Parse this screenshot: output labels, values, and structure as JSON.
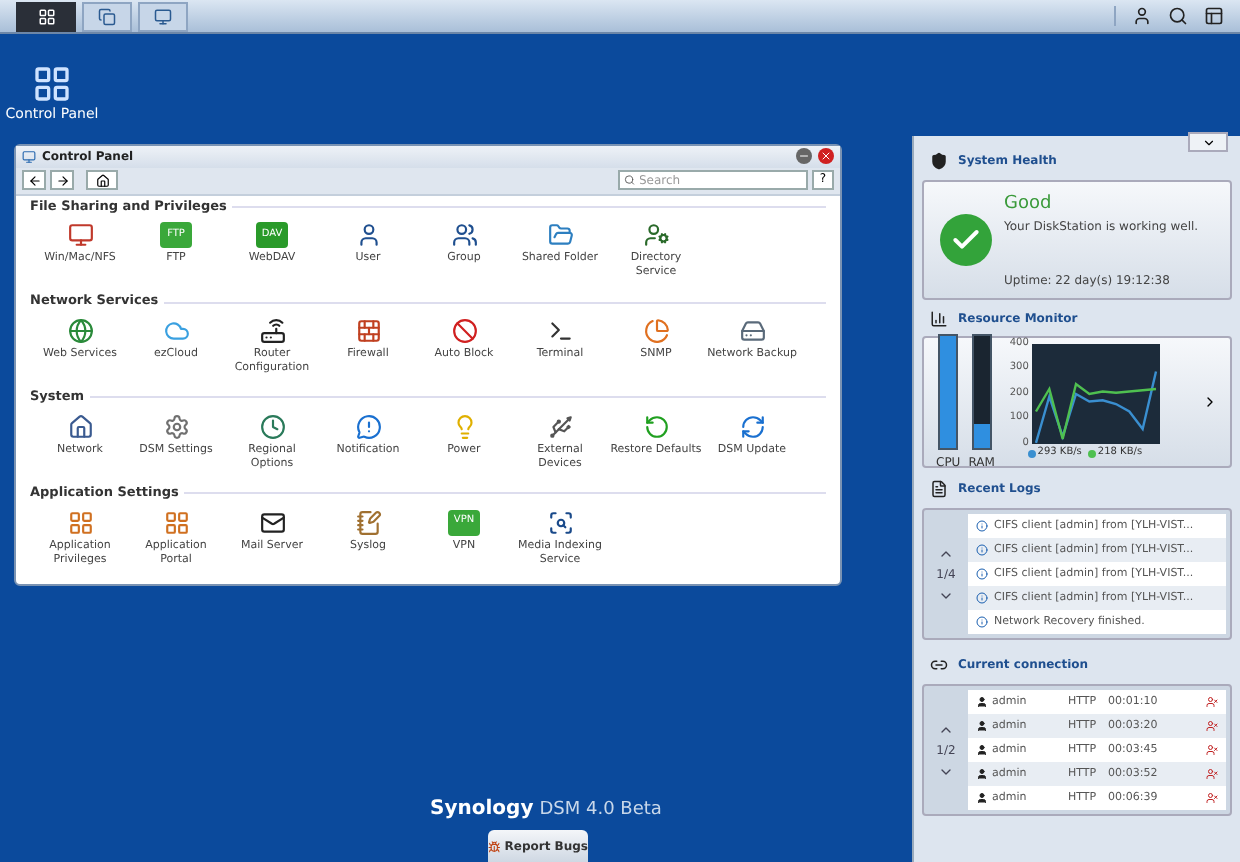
{
  "taskbar": {
    "buttons": [
      {
        "selected": true
      },
      {
        "selected": false
      },
      {
        "selected": false
      }
    ]
  },
  "desktop_icons": [
    {
      "label": "Control Panel"
    }
  ],
  "control_panel": {
    "title": "Control Panel",
    "search": {
      "placeholder": "Search"
    },
    "help": "?",
    "sections": [
      {
        "title": "File Sharing and Privileges",
        "items": [
          {
            "label": "Win/Mac/NFS"
          },
          {
            "label": "FTP",
            "badge": "FTP"
          },
          {
            "label": "WebDAV",
            "badge": "DAV"
          },
          {
            "label": "User"
          },
          {
            "label": "Group"
          },
          {
            "label": "Shared Folder"
          },
          {
            "label": "Directory Service"
          }
        ]
      },
      {
        "title": "Network Services",
        "items": [
          {
            "label": "Web Services"
          },
          {
            "label": "ezCloud"
          },
          {
            "label": "Router Configuration"
          },
          {
            "label": "Firewall"
          },
          {
            "label": "Auto Block"
          },
          {
            "label": "Terminal"
          },
          {
            "label": "SNMP"
          },
          {
            "label": "Network Backup"
          }
        ]
      },
      {
        "title": "System",
        "items": [
          {
            "label": "Network"
          },
          {
            "label": "DSM Settings"
          },
          {
            "label": "Regional Options"
          },
          {
            "label": "Notification"
          },
          {
            "label": "Power"
          },
          {
            "label": "External Devices"
          },
          {
            "label": "Restore Defaults"
          },
          {
            "label": "DSM Update"
          }
        ]
      },
      {
        "title": "Application Settings",
        "items": [
          {
            "label": "Application Privileges"
          },
          {
            "label": "Application Portal"
          },
          {
            "label": "Mail Server"
          },
          {
            "label": "Syslog"
          },
          {
            "label": "VPN",
            "badge": "VPN"
          },
          {
            "label": "Media Indexing Service"
          }
        ]
      }
    ]
  },
  "widgets": {
    "system_health": {
      "title": "System Health",
      "status": "Good",
      "message": "Your DiskStation is working well.",
      "uptime": "Uptime: 22 day(s) 19:12:38"
    },
    "resource_monitor": {
      "title": "Resource Monitor",
      "cpu": {
        "label": "CPU",
        "level": 1.0
      },
      "ram": {
        "label": "RAM",
        "level": 0.2
      },
      "chart_data": {
        "type": "line",
        "yticks": [
          0,
          100,
          200,
          300,
          400
        ],
        "ylim": [
          0,
          400
        ],
        "series": [
          {
            "name": "293 KB/s",
            "color": "#3a8fd0",
            "values": [
              0,
              190,
              30,
              200,
              170,
              175,
              160,
              130,
              60,
              290
            ]
          },
          {
            "name": "218 KB/s",
            "color": "#4fc050",
            "values": [
              130,
              220,
              20,
              240,
              200,
              210,
              205,
              210,
              215,
              220
            ]
          }
        ]
      }
    },
    "recent_logs": {
      "title": "Recent Logs",
      "page": "1/4",
      "rows": [
        {
          "text": "CIFS client [admin] from [YLH-VIST..."
        },
        {
          "text": "CIFS client [admin] from [YLH-VIST..."
        },
        {
          "text": "CIFS client [admin] from [YLH-VIST..."
        },
        {
          "text": "CIFS client [admin] from [YLH-VIST..."
        },
        {
          "text": "Network Recovery finished."
        }
      ]
    },
    "current_connection": {
      "title": "Current connection",
      "page": "1/2",
      "rows": [
        {
          "user": "admin",
          "protocol": "HTTP",
          "time": "00:01:10"
        },
        {
          "user": "admin",
          "protocol": "HTTP",
          "time": "00:03:20"
        },
        {
          "user": "admin",
          "protocol": "HTTP",
          "time": "00:03:45"
        },
        {
          "user": "admin",
          "protocol": "HTTP",
          "time": "00:03:52"
        },
        {
          "user": "admin",
          "protocol": "HTTP",
          "time": "00:06:39"
        }
      ]
    }
  },
  "branding": {
    "brand": "Synology",
    "product": "DSM 4.0 Beta"
  },
  "report_button": {
    "label": "Report Bugs"
  }
}
